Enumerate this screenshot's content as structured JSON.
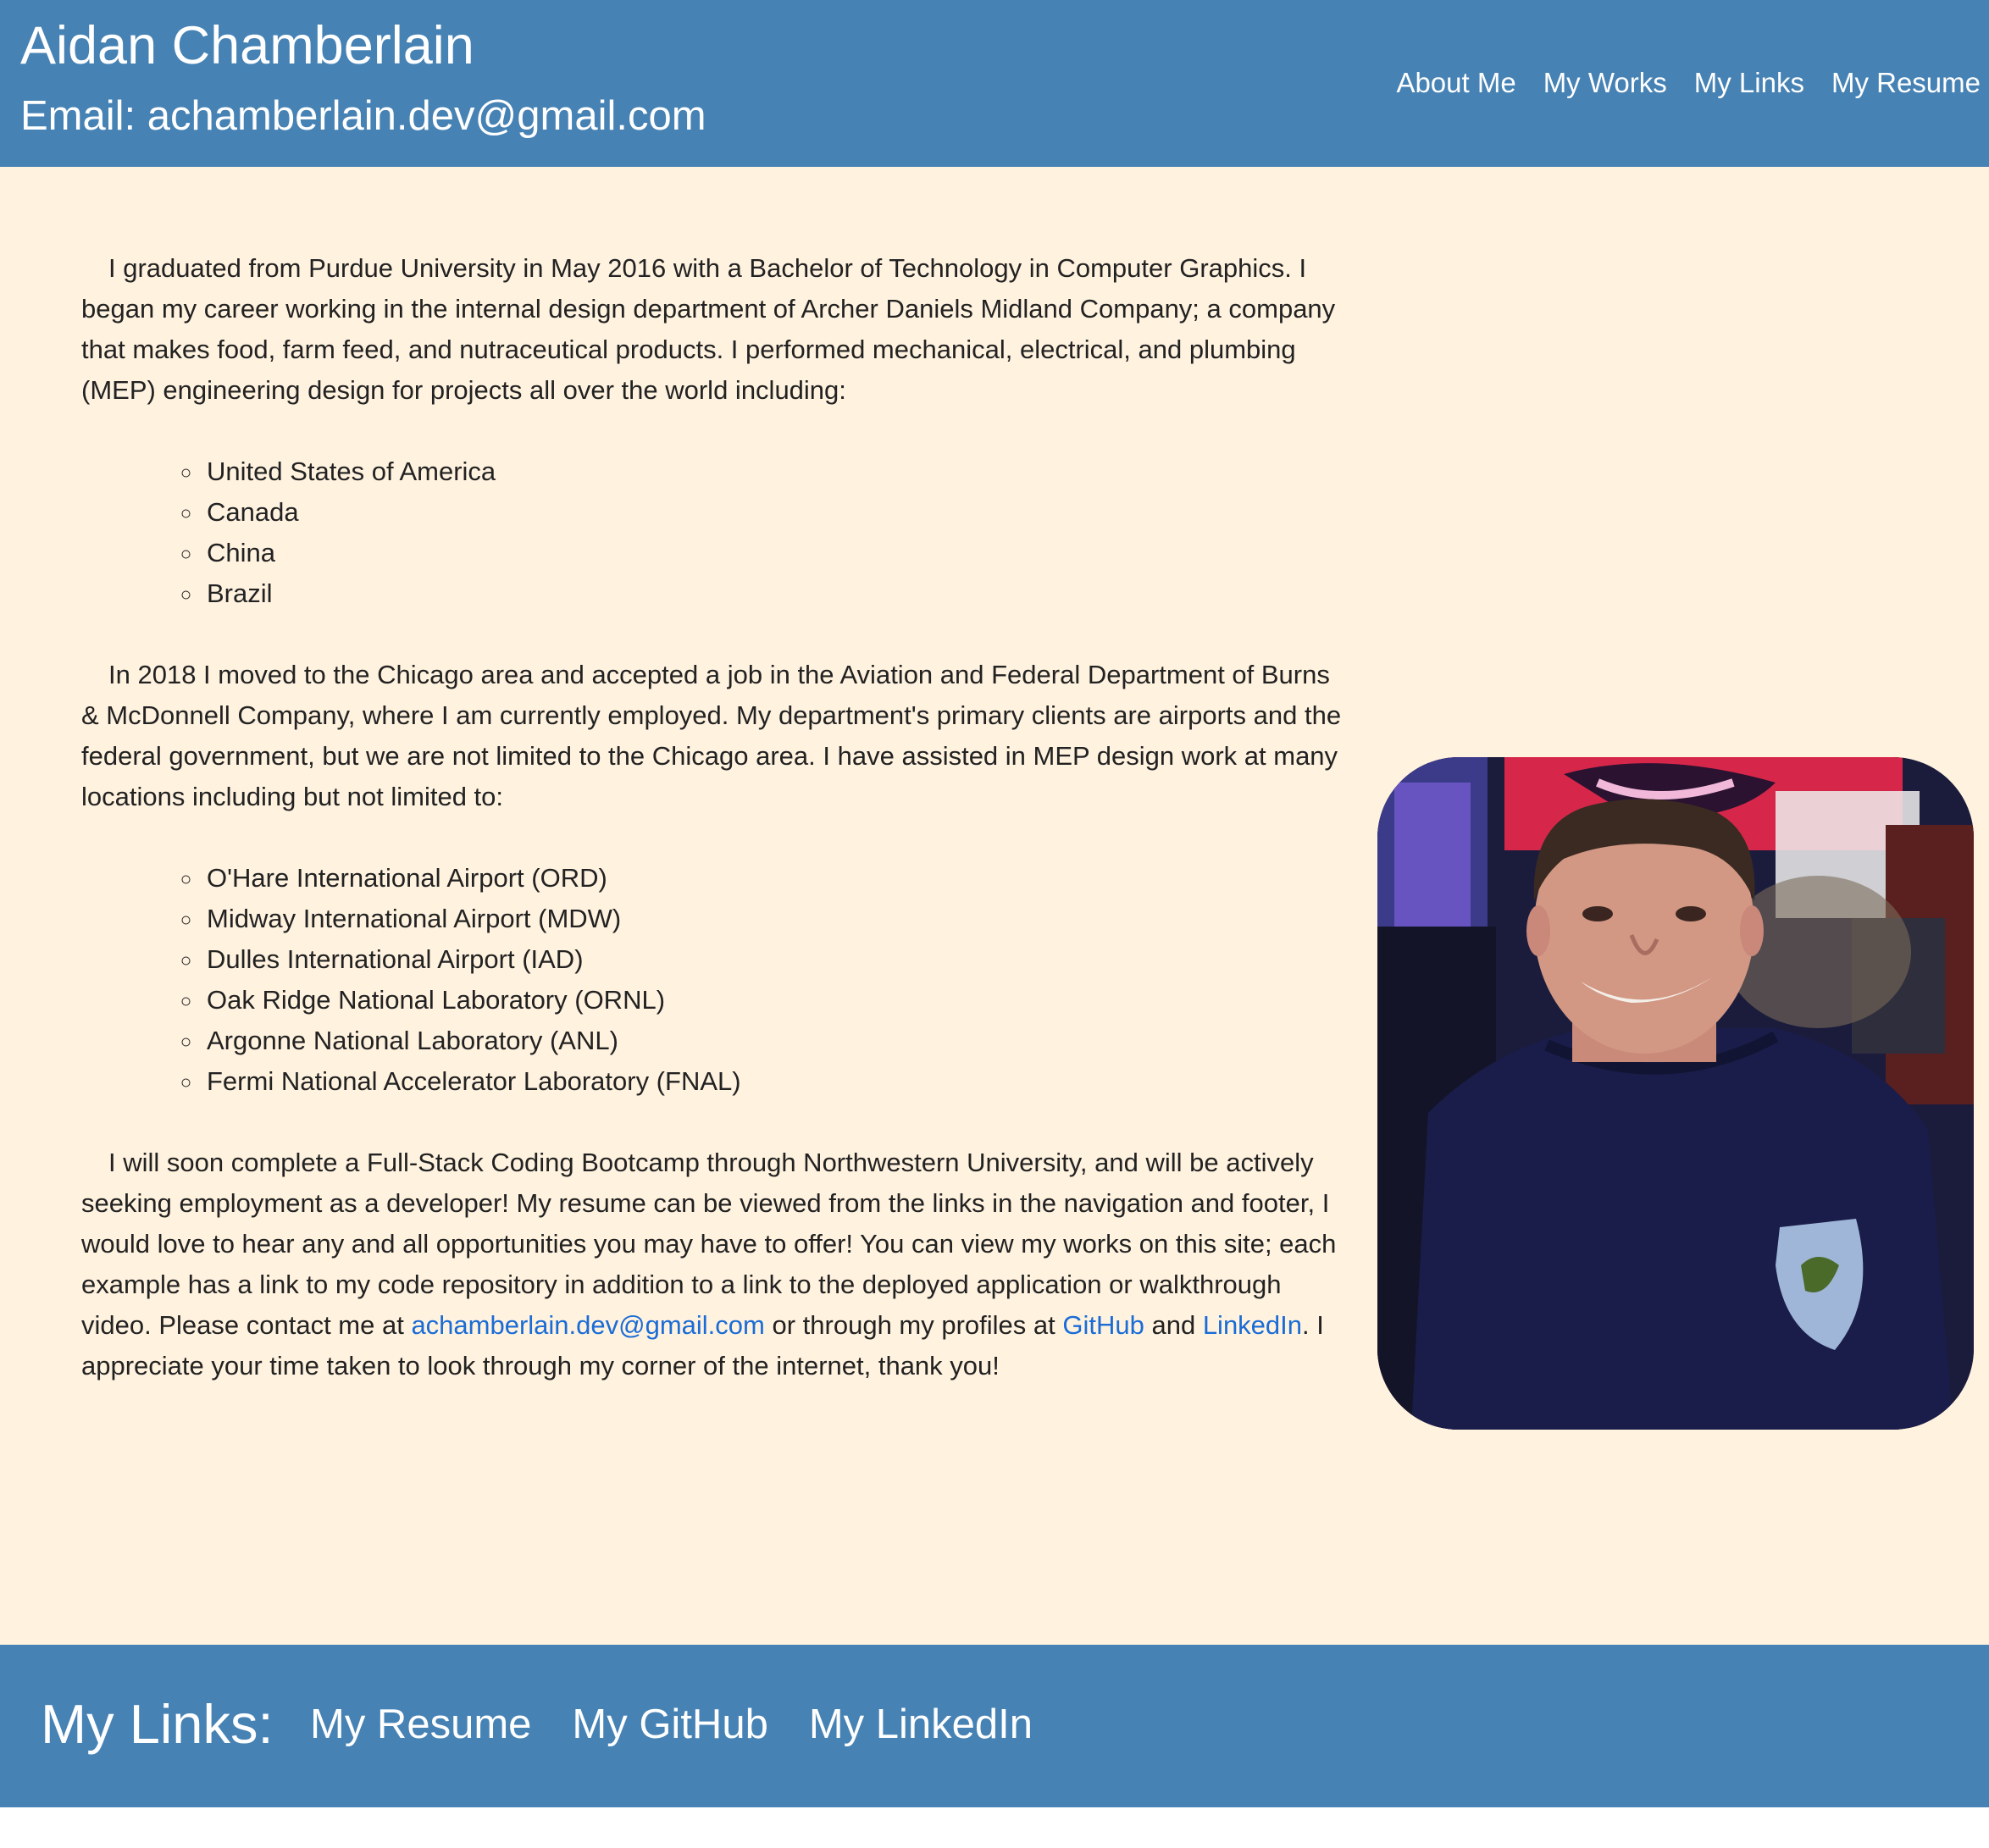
{
  "header": {
    "name": "Aidan Chamberlain",
    "email": "Email: achamberlain.dev@gmail.com",
    "nav": [
      "About Me",
      "My Works",
      "My Links",
      "My Resume"
    ]
  },
  "about": {
    "p1": "I graduated from Purdue University in May 2016 with a Bachelor of Technology in Computer Graphics. I began my career working in the internal design department of Archer Daniels Midland Company; a company that makes food, farm feed, and nutraceutical products. I performed mechanical, electrical, and plumbing (MEP) engineering design for projects all over the world including:",
    "countries": [
      "United States of America",
      "Canada",
      "China",
      "Brazil"
    ],
    "p2": "In 2018 I moved to the Chicago area and accepted a job in the Aviation and Federal Department of Burns & McDonnell Company, where I am currently employed. My department's primary clients are airports and the federal government, but we are not limited to the Chicago area. I have assisted in MEP design work at many locations including but not limited to:",
    "locations": [
      "O'Hare International Airport (ORD)",
      "Midway International Airport (MDW)",
      "Dulles International Airport (IAD)",
      "Oak Ridge National Laboratory (ORNL)",
      "Argonne National Laboratory (ANL)",
      "Fermi National Accelerator Laboratory (FNAL)"
    ],
    "p3_a": "I will soon complete a Full-Stack Coding Bootcamp through Northwestern University, and will be actively seeking employment as a developer! My resume can be viewed from the links in the navigation and footer, I would love to hear any and all opportunities you may have to offer! You can view my works on this site; each example has a link to my code repository in addition to a link to the deployed application or walkthrough video. Please contact me at ",
    "p3_email": "achamberlain.dev@gmail.com",
    "p3_b": " or through my profiles at ",
    "p3_github": "GitHub",
    "p3_c": " and ",
    "p3_linkedin": "LinkedIn",
    "p3_d": ". I appreciate your time taken to look through my corner of the internet, thank you!"
  },
  "footer": {
    "title": "My Links:",
    "links": [
      "My Resume",
      "My GitHub",
      "My LinkedIn"
    ]
  },
  "colors": {
    "header_bg": "#4682b4",
    "page_bg": "#fff2df",
    "link": "#1a6cd6"
  }
}
